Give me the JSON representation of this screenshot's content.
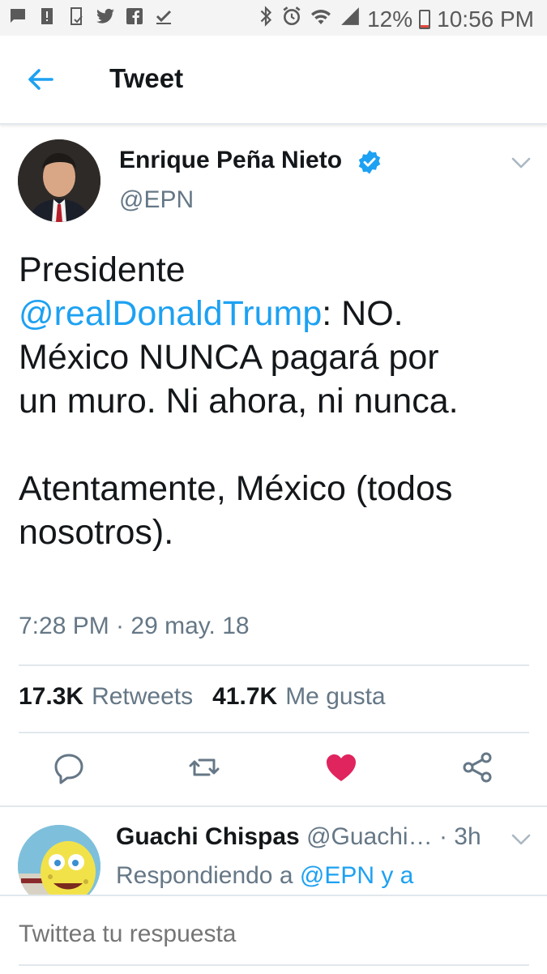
{
  "status_bar": {
    "battery": "12%",
    "time": "10:56 PM",
    "battery_level": 0.12,
    "left_icons": [
      "message-icon",
      "alert-icon",
      "screenshot-icon",
      "twitter-icon",
      "facebook-icon",
      "check-icon"
    ],
    "right_icons": [
      "bluetooth-icon",
      "alarm-icon",
      "wifi-icon",
      "signal-icon",
      "battery-icon"
    ]
  },
  "header": {
    "title": "Tweet",
    "back_icon": "back-arrow-icon"
  },
  "tweet": {
    "author_name": "Enrique Peña Nieto",
    "author_handle": "@EPN",
    "verified": true,
    "text_before": "Presidente\n",
    "mention": "@realDonaldTrump",
    "text_after": ": NO.\nMéxico NUNCA pagará por\nun muro. Ni ahora, ni nunca.\n\nAtentamente, México (todos\nnosotros).",
    "timestamp": "7:28 PM · 29 may. 18",
    "retweets_count": "17.3K",
    "retweets_label": "Retweets",
    "likes_count": "41.7K",
    "likes_label": "Me gusta",
    "liked": true,
    "accent_color": "#1da1f2",
    "like_color": "#e0245e"
  },
  "reply": {
    "author_name": "Guachi Chispas",
    "author_handle": "@Guachi…",
    "time": "· 3h",
    "context_prefix": "Respondiendo a ",
    "context_mention": "@EPN y a"
  },
  "compose": {
    "placeholder": "Twittea tu respuesta"
  }
}
